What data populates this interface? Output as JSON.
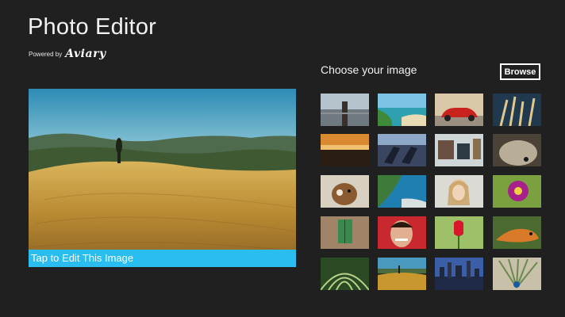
{
  "app": {
    "title": "Photo Editor",
    "powered_by": "Powered by",
    "brand": "Aviary"
  },
  "hero": {
    "caption": "Tap to Edit This Image"
  },
  "gallery": {
    "heading": "Choose your image",
    "browse_label": "Browse",
    "thumbnails": [
      {
        "subject": "pier"
      },
      {
        "subject": "tropical-beach"
      },
      {
        "subject": "red-car"
      },
      {
        "subject": "wheat-grass"
      },
      {
        "subject": "sunset"
      },
      {
        "subject": "lounge-chairs"
      },
      {
        "subject": "street-market"
      },
      {
        "subject": "animal-closeup"
      },
      {
        "subject": "dog"
      },
      {
        "subject": "coastline"
      },
      {
        "subject": "woman-portrait"
      },
      {
        "subject": "purple-flower"
      },
      {
        "subject": "green-shutter"
      },
      {
        "subject": "smiling-man"
      },
      {
        "subject": "red-tulip"
      },
      {
        "subject": "iguana"
      },
      {
        "subject": "cactus"
      },
      {
        "subject": "tuscan-field"
      },
      {
        "subject": "city-skyline"
      },
      {
        "subject": "peacock"
      }
    ]
  },
  "colors": {
    "background": "#202020",
    "accent": "#29bdf0"
  }
}
